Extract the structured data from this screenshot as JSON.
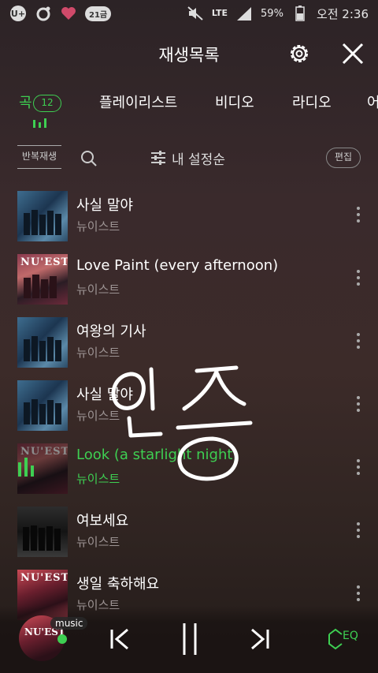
{
  "status_bar": {
    "left_icons": [
      "u-plus-icon",
      "ring-icon",
      "heart-icon",
      "badge-icon"
    ],
    "badge_text": "21금",
    "network": "LTE",
    "battery": "59%",
    "time": "오전 2:36"
  },
  "header": {
    "title": "재생목록"
  },
  "tabs": [
    {
      "label": "곡",
      "count": "12",
      "active": true
    },
    {
      "label": "플레이리스트",
      "active": false
    },
    {
      "label": "비디오",
      "active": false
    },
    {
      "label": "라디오",
      "active": false
    },
    {
      "label": "어",
      "active": false
    }
  ],
  "toolbar": {
    "repeat_label": "반복재생",
    "sort_label": "내 설정순",
    "edit_label": "편집"
  },
  "songs": [
    {
      "title": "사실 말야",
      "artist": "뉴이스트",
      "art": "blue",
      "playing": false
    },
    {
      "title": "Love Paint (every afternoon)",
      "artist": "뉴이스트",
      "art": "pink",
      "art_text": "NU'EST",
      "playing": false
    },
    {
      "title": "여왕의 기사",
      "artist": "뉴이스트",
      "art": "blue",
      "playing": false
    },
    {
      "title": "사실 말야",
      "artist": "뉴이스트",
      "art": "blue",
      "playing": false
    },
    {
      "title": "Look (a starlight night)",
      "artist": "뉴이스트",
      "art": "pink",
      "art_text": "NU'EST",
      "playing": true
    },
    {
      "title": "여보세요",
      "artist": "뉴이스트",
      "art": "dark",
      "playing": false
    },
    {
      "title": "생일 축하해요",
      "artist": "뉴이스트",
      "art": "red",
      "art_text": "NU'EST",
      "playing": false
    }
  ],
  "overlay_handwriting": "인증",
  "player": {
    "source_tag": "music",
    "mini_art_text": "NU'EST",
    "eq_label": "EQ",
    "accent_color": "#3ecf52"
  }
}
